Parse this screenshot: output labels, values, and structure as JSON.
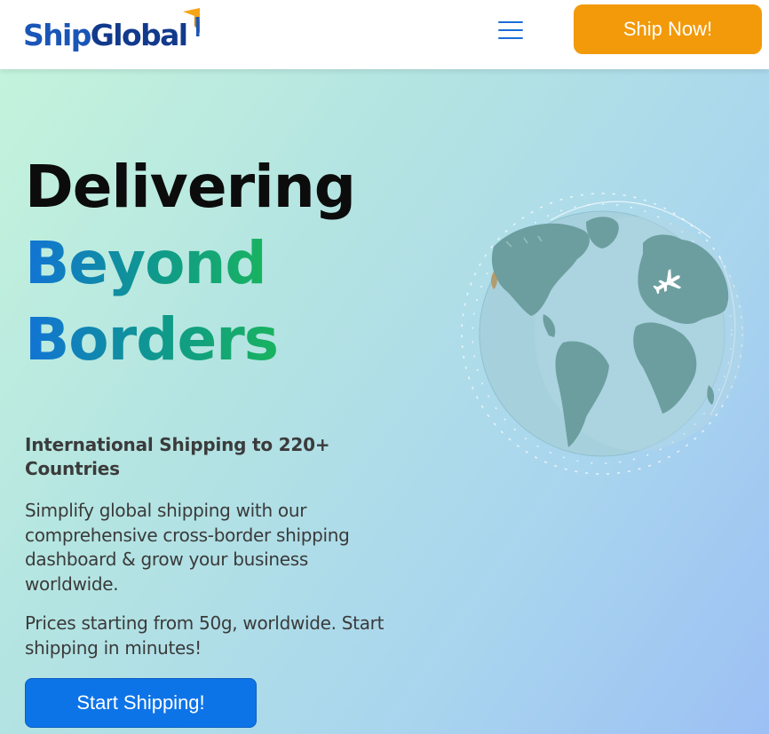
{
  "header": {
    "logo": {
      "part1": "Ship",
      "part2": "Global"
    },
    "menu_icon": "hamburger-menu-icon",
    "cta_label": "Ship Now!"
  },
  "hero": {
    "headline": {
      "line1": "Delivering",
      "line2": "Beyond",
      "line3": "Borders"
    },
    "subheadline": "International Shipping to 220+ Countries",
    "paragraph1": "Simplify global shipping with our comprehensive cross-border shipping dashboard & grow your business worldwide.",
    "paragraph2": "Prices starting from 50g, worldwide. Start shipping in minutes!",
    "cta_label": "Start Shipping!",
    "illustration": "globe-with-airplane-icon"
  },
  "colors": {
    "brand_blue": "#1a56b8",
    "accent_orange": "#f29a0a",
    "primary_button": "#0d74e8",
    "gradient_start": "#1273d6",
    "gradient_end": "#19b35f"
  }
}
